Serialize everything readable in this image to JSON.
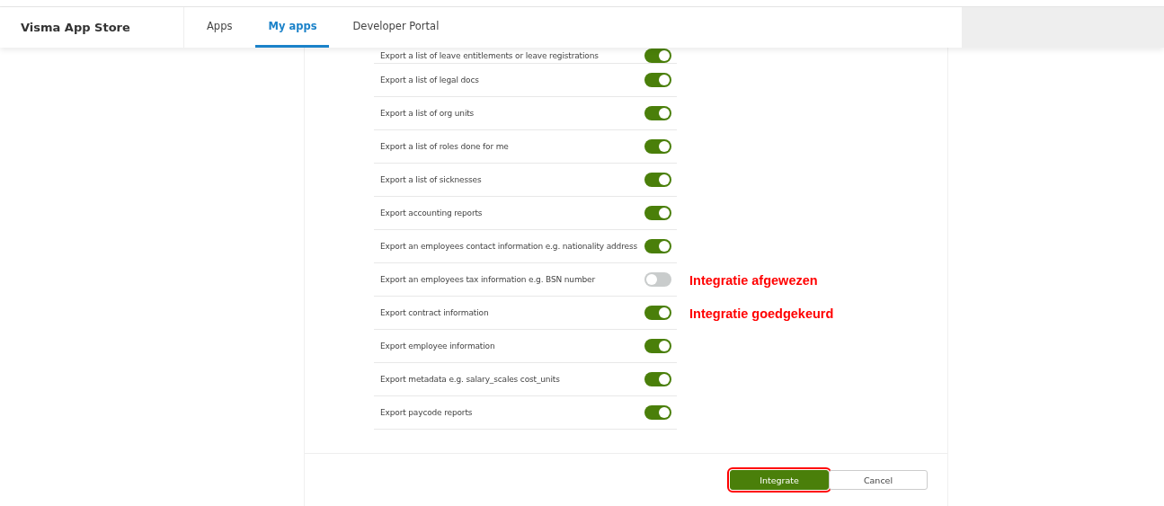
{
  "header": {
    "brand": "Visma App Store",
    "tabs": [
      {
        "label": "Apps",
        "selected": false
      },
      {
        "label": "My apps",
        "selected": true
      },
      {
        "label": "Developer Portal",
        "selected": false
      }
    ]
  },
  "permissions": [
    {
      "label": "Export a list of leave entitlements or leave registrations",
      "on": true
    },
    {
      "label": "Export a list of legal docs",
      "on": true
    },
    {
      "label": "Export a list of org units",
      "on": true
    },
    {
      "label": "Export a list of roles done for me",
      "on": true
    },
    {
      "label": "Export a list of sicknesses",
      "on": true
    },
    {
      "label": "Export accounting reports",
      "on": true
    },
    {
      "label": "Export an employees contact information e.g. nationality address",
      "on": true
    },
    {
      "label": "Export an employees tax information e.g. BSN number",
      "on": false,
      "annotation": "Integratie afgewezen"
    },
    {
      "label": "Export contract information",
      "on": true,
      "annotation": "Integratie goedgekeurd"
    },
    {
      "label": "Export employee information",
      "on": true
    },
    {
      "label": "Export metadata e.g. salary_scales cost_units",
      "on": true
    },
    {
      "label": "Export paycode reports",
      "on": true
    }
  ],
  "buttons": [
    {
      "label": "Integrate",
      "kind": "primary",
      "highlighted": true
    },
    {
      "label": "Cancel",
      "kind": "secondary",
      "highlighted": false
    }
  ]
}
